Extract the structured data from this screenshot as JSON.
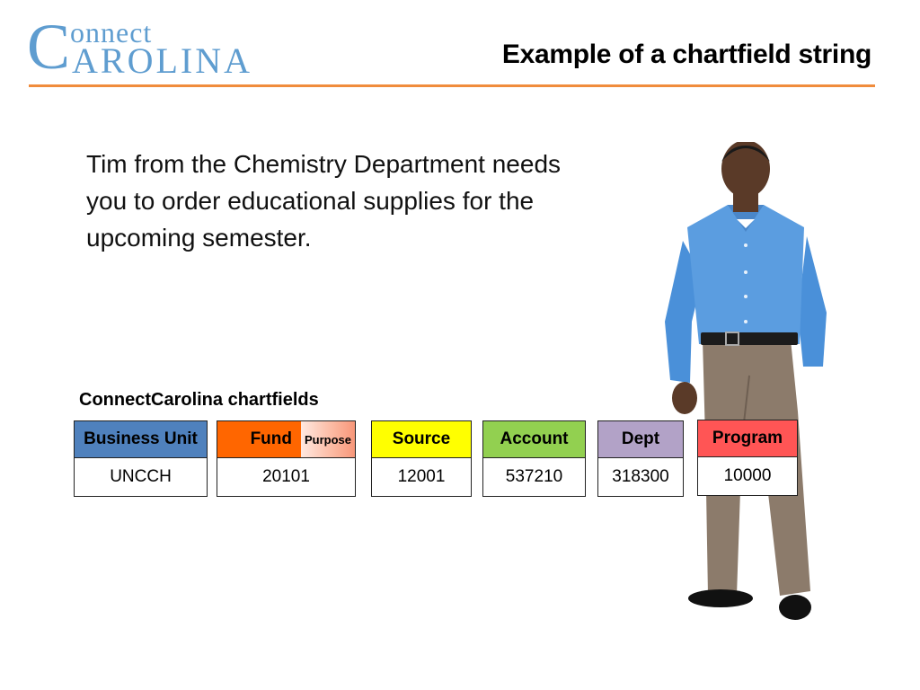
{
  "logo": {
    "first_letter": "C",
    "line1": "onnect",
    "line2": "AROLINA"
  },
  "header": {
    "title": "Example of a chartfield string"
  },
  "intro": {
    "text": "Tim from the Chemistry Department needs you to order educational supplies for the upcoming semester."
  },
  "chartfields": {
    "label": "ConnectCarolina chartfields",
    "fields": [
      {
        "name": "Business Unit",
        "value": "UNCCH",
        "color": "#4f81bd"
      },
      {
        "name": "Fund",
        "sub_label": "Purpose",
        "value": "20101",
        "color": "#ff6600"
      },
      {
        "name": "Source",
        "value": "12001",
        "color": "#ffff00"
      },
      {
        "name": "Account",
        "value": "537210",
        "color": "#92d050"
      },
      {
        "name": "Dept",
        "value": "318300",
        "color": "#b2a2c7"
      },
      {
        "name": "Program",
        "value": "10000",
        "color": "#ff5555"
      }
    ]
  },
  "colors": {
    "brand_blue": "#5f9dd0",
    "accent_orange": "#f08c3c"
  },
  "image": {
    "subject": "man-in-blue-shirt-photo"
  }
}
